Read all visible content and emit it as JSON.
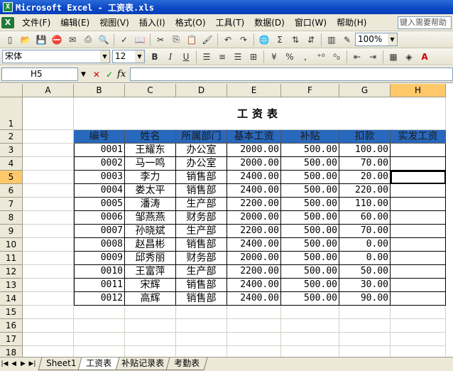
{
  "window": {
    "title": "Microsoft Excel - 工资表.xls"
  },
  "menu": [
    "文件(F)",
    "编辑(E)",
    "视图(V)",
    "插入(I)",
    "格式(O)",
    "工具(T)",
    "数据(D)",
    "窗口(W)",
    "帮助(H)"
  ],
  "help_search": {
    "placeholder": "键入需要帮助"
  },
  "toolbar": {
    "zoom": "100%",
    "font_name": "宋体",
    "font_size": "12",
    "bold": "B",
    "italic": "I",
    "underline": "U",
    "percent": "%",
    "comma": ","
  },
  "formula_bar": {
    "name_box": "H5",
    "cancel": "✕",
    "enter": "✓",
    "fx": "fx",
    "value": ""
  },
  "sheet": {
    "columns": [
      "A",
      "B",
      "C",
      "D",
      "E",
      "F",
      "G",
      "H"
    ],
    "rows": [
      "1",
      "2",
      "3",
      "4",
      "5",
      "6",
      "7",
      "8",
      "9",
      "10",
      "11",
      "12",
      "13",
      "14",
      "15",
      "16",
      "17",
      "18"
    ],
    "active_column": "H",
    "active_row": "5",
    "title": "工资表",
    "headers": [
      "编号",
      "姓名",
      "所属部门",
      "基本工资",
      "补贴",
      "扣款",
      "实发工资"
    ],
    "data": [
      [
        "0001",
        "王耀东",
        "办公室",
        "2000.00",
        "500.00",
        "100.00",
        ""
      ],
      [
        "0002",
        "马一鸣",
        "办公室",
        "2000.00",
        "500.00",
        "70.00",
        ""
      ],
      [
        "0003",
        "李力",
        "销售部",
        "2400.00",
        "500.00",
        "20.00",
        ""
      ],
      [
        "0004",
        "娄太平",
        "销售部",
        "2400.00",
        "500.00",
        "220.00",
        ""
      ],
      [
        "0005",
        "潘涛",
        "生产部",
        "2200.00",
        "500.00",
        "110.00",
        ""
      ],
      [
        "0006",
        "邹燕燕",
        "财务部",
        "2000.00",
        "500.00",
        "60.00",
        ""
      ],
      [
        "0007",
        "孙晓斌",
        "生产部",
        "2200.00",
        "500.00",
        "70.00",
        ""
      ],
      [
        "0008",
        "赵昌彬",
        "销售部",
        "2400.00",
        "500.00",
        "0.00",
        ""
      ],
      [
        "0009",
        "邱秀丽",
        "财务部",
        "2000.00",
        "500.00",
        "0.00",
        ""
      ],
      [
        "0010",
        "王富萍",
        "生产部",
        "2200.00",
        "500.00",
        "50.00",
        ""
      ],
      [
        "0011",
        "宋辉",
        "销售部",
        "2400.00",
        "500.00",
        "30.00",
        ""
      ],
      [
        "0012",
        "高辉",
        "销售部",
        "2400.00",
        "500.00",
        "90.00",
        ""
      ]
    ]
  },
  "sheet_tabs": [
    "Sheet1",
    "工资表",
    "补贴记录表",
    "考勤表"
  ],
  "active_tab": "工资表",
  "colors": {
    "header_fill": "#2868bd",
    "title_bar": "#0a46c4",
    "active_header": "#ffc96b"
  }
}
